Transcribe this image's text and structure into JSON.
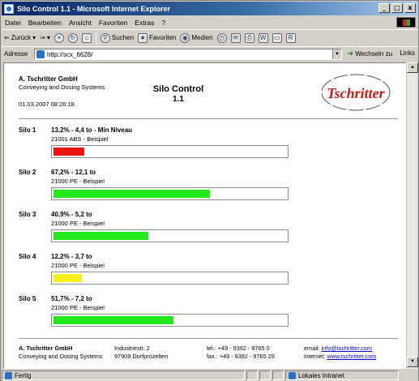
{
  "window": {
    "title": "Silo Control 1.1 - Microsoft Internet Explorer",
    "buttons": [
      "_",
      "□",
      "x"
    ]
  },
  "menubar": {
    "items": [
      "Datei",
      "Bearbeiten",
      "Ansicht",
      "Favoriten",
      "Extras",
      "?"
    ]
  },
  "toolbar": {
    "back": "Zurück",
    "search": "Suchen",
    "favorites": "Favoriten",
    "media": "Medien"
  },
  "addressbar": {
    "label": "Adresse",
    "url": "http://scx_6628/",
    "go": "Wechseln zu",
    "links": "Links"
  },
  "header": {
    "company": "A. Tschritter GmbH",
    "subtitle": "Conveying and Dosing Systems",
    "timestamp": "01.03.2007 08:26:18",
    "app_title": "Silo Control",
    "app_version": "1.1",
    "logo_text": "Tschritter"
  },
  "silos": [
    {
      "label": "Silo 1",
      "stats": "13,2% - 4,4 to - Min Niveau",
      "product": "21001 ABS - Beispiel",
      "level": 0.132,
      "color": "#e8160f"
    },
    {
      "label": "Silo 2",
      "stats": "67,2% - 12,1 to",
      "product": "21000 PE - Beispiel",
      "level": 0.672,
      "color": "#22e81a"
    },
    {
      "label": "Silo 3",
      "stats": "40,9% - 5,2 to",
      "product": "21000 PE - Beispiel",
      "level": 0.409,
      "color": "#22e81a"
    },
    {
      "label": "Silo 4",
      "stats": "12,2% - 3,7 to",
      "product": "21000 PE - Beispiel",
      "level": 0.122,
      "color": "#f5f01a"
    },
    {
      "label": "Silo 5",
      "stats": "51,7% - 7,2 to",
      "product": "21000 PE - Beispiel",
      "level": 0.517,
      "color": "#22e81a"
    }
  ],
  "footer": {
    "company": "A. Tschritter GmbH",
    "subtitle": "Conveying and Dosing Systems",
    "street": "Industriestr. 2",
    "city": "97909 Dorfprozelten",
    "tel": "tel.: +49 - 9392 - 9765 0",
    "fax": "fax.: +49 - 9392 - 9765 29",
    "email_label": "email:",
    "email": "info@tschritter.com",
    "internet_label": "internet:",
    "website": "www.tschritter.com"
  },
  "statusbar": {
    "status": "Fertig",
    "zone": "Lokales Intranet"
  }
}
